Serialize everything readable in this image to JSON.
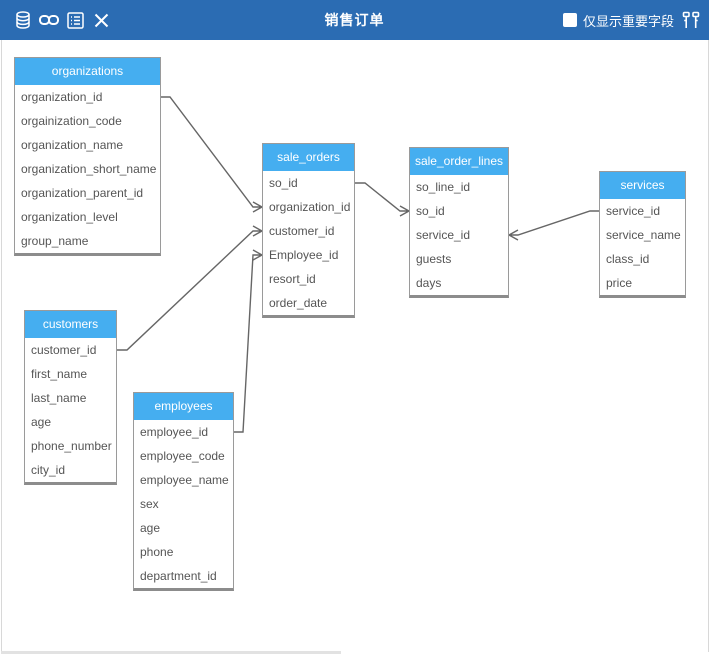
{
  "toolbar": {
    "title": "销售订单",
    "toggle_label": "仅显示重要字段",
    "toggle_checked": false,
    "icons": [
      "database-icon",
      "link-icon",
      "list-icon",
      "close-icon",
      "layout-icon"
    ],
    "colors": {
      "bar": "#2b6cb3",
      "header": "#45aef0"
    }
  },
  "diagram": {
    "entities": [
      {
        "id": "organizations",
        "name": "organizations",
        "fields": [
          "organization_id",
          "orgainization_code",
          "organization_name",
          "organization_short_name",
          "organization_parent_id",
          "organization_level",
          "group_name"
        ]
      },
      {
        "id": "customers",
        "name": "customers",
        "fields": [
          "customer_id",
          "first_name",
          "last_name",
          "age",
          "phone_number",
          "city_id"
        ]
      },
      {
        "id": "employees",
        "name": "employees",
        "fields": [
          "employee_id",
          "employee_code",
          "employee_name",
          "sex",
          "age",
          "phone",
          "department_id"
        ]
      },
      {
        "id": "sale_orders",
        "name": "sale_orders",
        "fields": [
          "so_id",
          "organization_id",
          "customer_id",
          "Employee_id",
          "resort_id",
          "order_date"
        ]
      },
      {
        "id": "sale_order_lines",
        "name": "sale_order_lines",
        "fields": [
          "so_line_id",
          "so_id",
          "service_id",
          "guests",
          "days"
        ]
      },
      {
        "id": "services",
        "name": "services",
        "fields": [
          "service_id",
          "service_name",
          "class_id",
          "price"
        ]
      }
    ],
    "relations": [
      {
        "from": "organizations.organization_id",
        "to": "sale_orders.organization_id",
        "cardinality": "one-to-many"
      },
      {
        "from": "customers.customer_id",
        "to": "sale_orders.customer_id",
        "cardinality": "one-to-many"
      },
      {
        "from": "employees.employee_id",
        "to": "sale_orders.Employee_id",
        "cardinality": "one-to-many"
      },
      {
        "from": "sale_orders.so_id",
        "to": "sale_order_lines.so_id",
        "cardinality": "one-to-many"
      },
      {
        "from": "services.service_id",
        "to": "sale_order_lines.service_id",
        "cardinality": "one-to-many"
      }
    ]
  }
}
